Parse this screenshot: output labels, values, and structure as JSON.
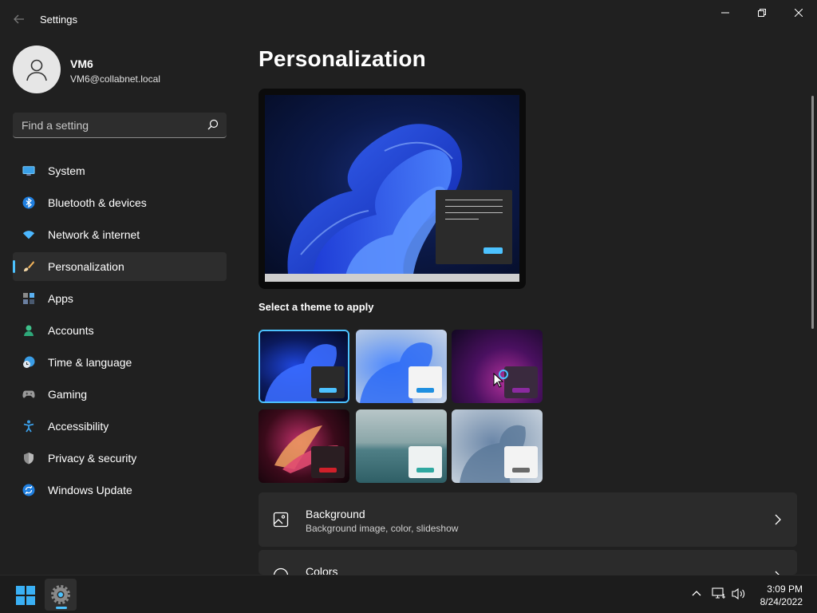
{
  "window": {
    "title": "Settings"
  },
  "profile": {
    "name": "VM6",
    "email": "VM6@collabnet.local"
  },
  "search": {
    "placeholder": "Find a setting"
  },
  "nav": {
    "items": [
      {
        "label": "System",
        "icon": "monitor-icon",
        "selected": false
      },
      {
        "label": "Bluetooth & devices",
        "icon": "bluetooth-icon",
        "selected": false
      },
      {
        "label": "Network & internet",
        "icon": "wifi-icon",
        "selected": false
      },
      {
        "label": "Personalization",
        "icon": "brush-icon",
        "selected": true
      },
      {
        "label": "Apps",
        "icon": "apps-icon",
        "selected": false
      },
      {
        "label": "Accounts",
        "icon": "person-icon",
        "selected": false
      },
      {
        "label": "Time & language",
        "icon": "clock-globe-icon",
        "selected": false
      },
      {
        "label": "Gaming",
        "icon": "gamepad-icon",
        "selected": false
      },
      {
        "label": "Accessibility",
        "icon": "accessibility-icon",
        "selected": false
      },
      {
        "label": "Privacy & security",
        "icon": "shield-icon",
        "selected": false
      },
      {
        "label": "Windows Update",
        "icon": "update-icon",
        "selected": false
      }
    ]
  },
  "main": {
    "title": "Personalization",
    "themes_label": "Select a theme to apply",
    "cards": [
      {
        "title": "Background",
        "subtitle": "Background image, color, slideshow",
        "icon": "image-icon"
      },
      {
        "title": "Colors",
        "subtitle": "",
        "icon": "palette-icon"
      }
    ]
  },
  "taskbar": {
    "time": "3:09 PM",
    "date": "8/24/2022"
  },
  "colors": {
    "accent": "#4cc2ff",
    "background": "#202020",
    "card": "#2b2b2b"
  }
}
